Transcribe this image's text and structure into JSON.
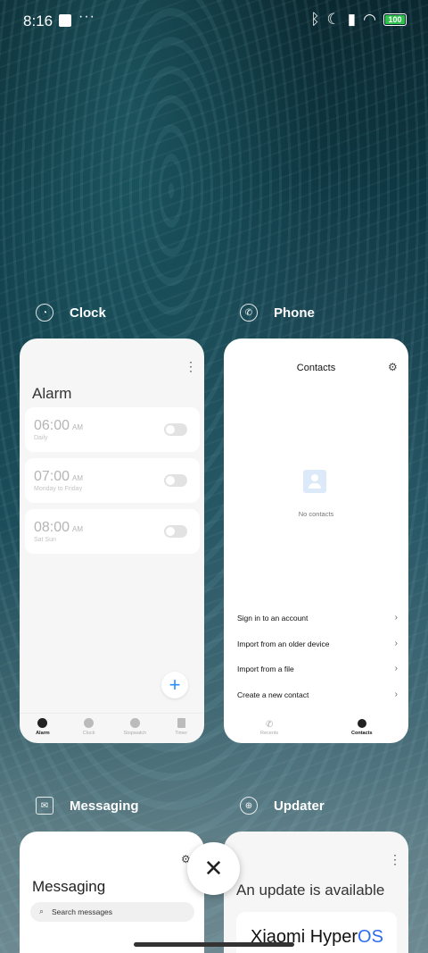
{
  "status_bar": {
    "time": "8:16",
    "dots": "···",
    "battery": "100",
    "bluetooth_icon": "bluetooth-icon",
    "moon_icon": "moon-icon",
    "signal_icon": "signal-icon",
    "wifi_icon": "wifi-icon"
  },
  "apps": {
    "clock": {
      "name": "Clock",
      "title": "Alarm",
      "alarms": [
        {
          "time": "06:00",
          "ampm": "AM",
          "repeat": "Daily"
        },
        {
          "time": "07:00",
          "ampm": "AM",
          "repeat": "Monday to Friday"
        },
        {
          "time": "08:00",
          "ampm": "AM",
          "repeat": "Sat Sun"
        }
      ],
      "nav": [
        "Alarm",
        "Clock",
        "Stopwatch",
        "Timer"
      ],
      "fab": "+"
    },
    "phone": {
      "name": "Phone",
      "title": "Contacts",
      "empty": "No contacts",
      "actions": [
        "Sign in to an account",
        "Import from an older device",
        "Import from a file",
        "Create a new contact"
      ],
      "nav": [
        "Recents",
        "Contacts"
      ]
    },
    "messaging": {
      "name": "Messaging",
      "title": "Messaging",
      "search_placeholder": "Search messages"
    },
    "updater": {
      "name": "Updater",
      "title": "An update is available",
      "brand_a": "Xiaomi Hyper",
      "brand_b": "OS"
    }
  },
  "controls": {
    "close": "✕"
  },
  "colors": {
    "battery": "#2ec24d",
    "accent": "#2b8cff"
  }
}
